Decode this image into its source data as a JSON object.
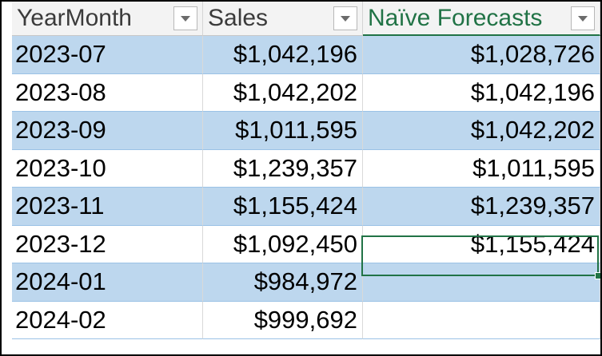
{
  "table": {
    "columns": [
      {
        "label": "YearMonth",
        "filter_icon": "chevron-down-icon"
      },
      {
        "label": "Sales",
        "filter_icon": "chevron-down-icon"
      },
      {
        "label": "Naïve Forecasts",
        "filter_icon": "chevron-down-icon",
        "active": true
      }
    ],
    "rows": [
      {
        "yearmonth": "2023-07",
        "sales": "$1,042,196",
        "forecast": "$1,028,726"
      },
      {
        "yearmonth": "2023-08",
        "sales": "$1,042,202",
        "forecast": "$1,042,196"
      },
      {
        "yearmonth": "2023-09",
        "sales": "$1,011,595",
        "forecast": "$1,042,202"
      },
      {
        "yearmonth": "2023-10",
        "sales": "$1,239,357",
        "forecast": "$1,011,595"
      },
      {
        "yearmonth": "2023-11",
        "sales": "$1,155,424",
        "forecast": "$1,239,357"
      },
      {
        "yearmonth": "2023-12",
        "sales": "$1,092,450",
        "forecast": "$1,155,424"
      },
      {
        "yearmonth": "2024-01",
        "sales": "$984,972",
        "forecast": ""
      },
      {
        "yearmonth": "2024-02",
        "sales": "$999,692",
        "forecast": ""
      }
    ],
    "selected_cell": {
      "row": 6,
      "column": "Naïve Forecasts"
    }
  },
  "colors": {
    "band": "#bdd7ee",
    "header_bg": "#f3f3f3",
    "active_header_text": "#217346",
    "selection_border": "#217346"
  }
}
